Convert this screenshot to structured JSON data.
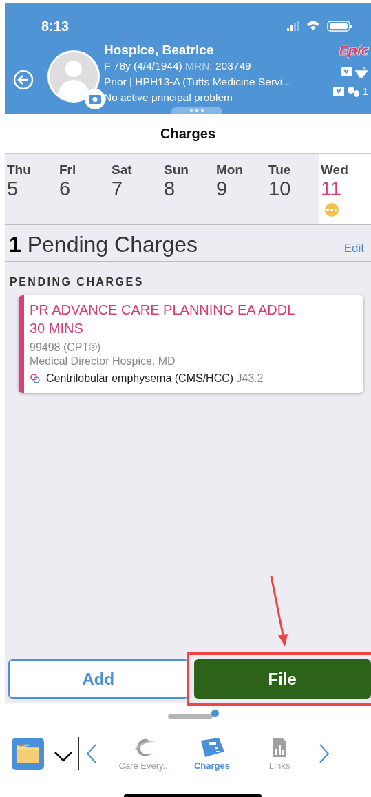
{
  "status_bar": {
    "time": "8:13"
  },
  "patient": {
    "name": "Hospice, Beatrice",
    "demographics": "F 78y (4/4/1944)",
    "mrn_label": "MRN:",
    "mrn": "203749",
    "encounter": "Prior | HPH13-A (Tufts Medicine Servi...",
    "problem": "No active principal problem",
    "logo": "Epic",
    "alert_count": "1"
  },
  "title": "Charges",
  "days": [
    {
      "weekday": "Thu",
      "day": "5",
      "selected": false
    },
    {
      "weekday": "Fri",
      "day": "6",
      "selected": false
    },
    {
      "weekday": "Sat",
      "day": "7",
      "selected": false
    },
    {
      "weekday": "Sun",
      "day": "8",
      "selected": false
    },
    {
      "weekday": "Mon",
      "day": "9",
      "selected": false
    },
    {
      "weekday": "Tue",
      "day": "10",
      "selected": false
    },
    {
      "weekday": "Wed",
      "day": "11",
      "selected": true
    }
  ],
  "summary": {
    "count": "1",
    "label": "Pending Charges",
    "edit": "Edit"
  },
  "section_label": "PENDING CHARGES",
  "charges": [
    {
      "title": "PR ADVANCE CARE PLANNING EA ADDL 30 MINS",
      "code": "99498 (CPT®)",
      "provider": "Medical Director Hospice, MD",
      "diagnosis": "Centrilobular emphysema (CMS/HCC)",
      "diagnosis_code": "J43.2"
    }
  ],
  "buttons": {
    "add": "Add",
    "file": "File"
  },
  "toolbar": [
    {
      "label": "Care Every...",
      "kind": "care",
      "selected": false
    },
    {
      "label": "Charges",
      "kind": "charges",
      "selected": true
    },
    {
      "label": "Links",
      "kind": "links",
      "selected": false
    }
  ]
}
